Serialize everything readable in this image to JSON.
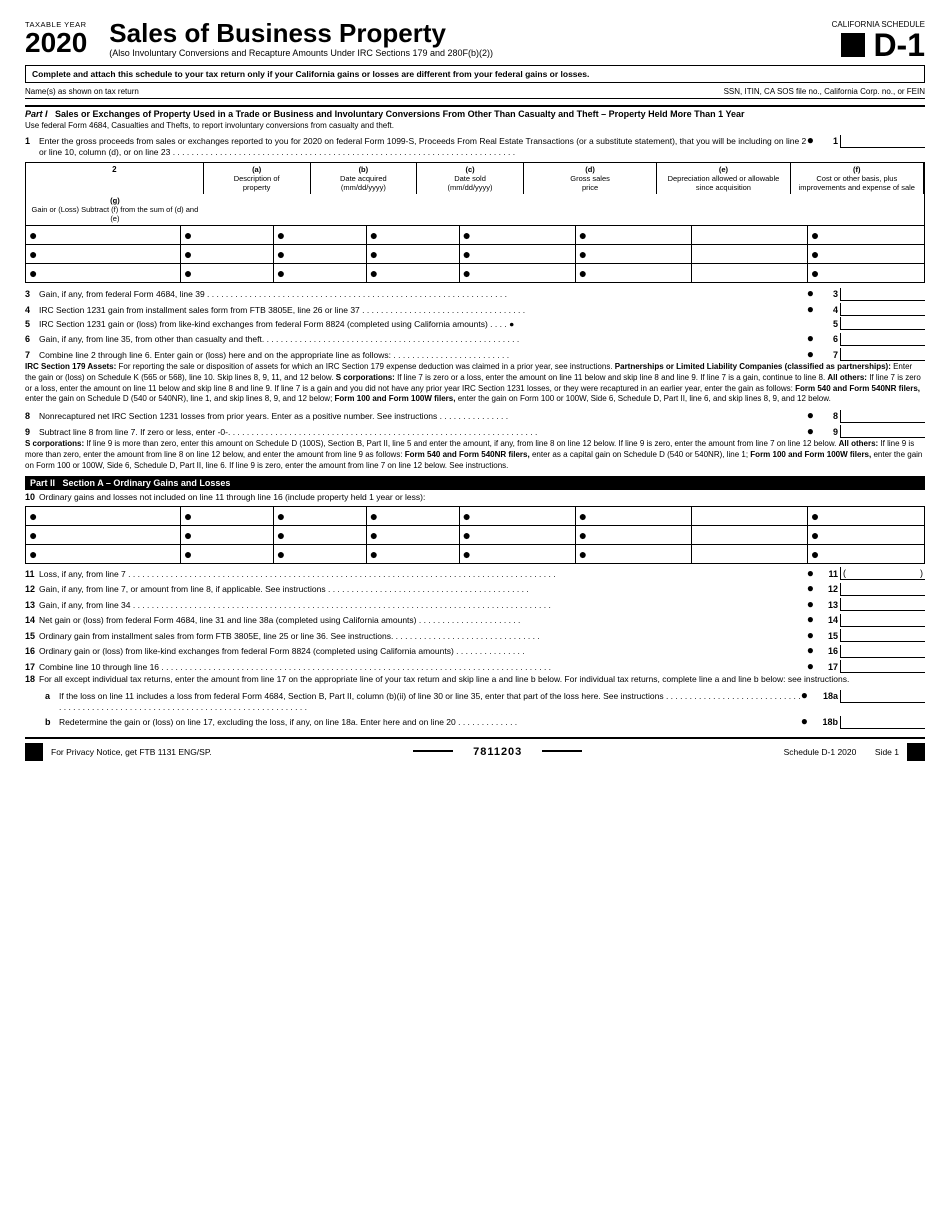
{
  "header": {
    "taxable_year_label": "TAXABLE YEAR",
    "year": "2020",
    "main_title": "Sales of Business Property",
    "subtitle": "(Also Involuntary Conversions and Recapture Amounts Under IRC Sections 179 and 280F(b)(2))",
    "ca_schedule": "CALIFORNIA SCHEDULE",
    "form_id": "D-1"
  },
  "warning": {
    "text_bold": "Complete and attach this schedule to your tax return only if your California gains or losses are different from your federal gains or losses.",
    "name_label": "Name(s) as shown on tax return",
    "ssn_label": "SSN, ITIN, CA SOS file no., California Corp. no., or FEIN"
  },
  "part1": {
    "label": "Part I",
    "title": "Sales or Exchanges of Property Used in a Trade or Business and Involuntary Conversions From Other Than Casualty and Theft – Property Held More Than 1 Year",
    "instruction": "Use federal Form 4684, Casualties and Thefts, to report involuntary conversions from casualty and theft.",
    "line1_text": "Enter the gross proceeds from sales or exchanges reported to you for 2020 on federal Form 1099-S, Proceeds From Real Estate Transactions (or a substitute statement), that you will be including on line 2 or line 10, column (d), or on line 23",
    "line1_num": "1",
    "table_col_a": "(a)\nDescription of property",
    "table_col_b": "(b)\nDate acquired\n(mm/dd/yyyy)",
    "table_col_c": "(c)\nDate sold\n(mm/dd/yyyy)",
    "table_col_d": "(d)\nGross sales\nprice",
    "table_col_e": "(e)\nDepreciation allowed or allowable since acquisition",
    "table_col_f": "(f)\nCost or other basis, plus improvements and expense of sale",
    "table_col_g": "(g)\nGain or (Loss) Subtract (f) from the sum of (d) and (e)",
    "line2_num": "2",
    "line3_text": "Gain, if any, from federal Form 4684, line 39",
    "line3_num": "3",
    "line4_text": "IRC Section 1231 gain from installment sales form from FTB 3805E, line 26 or line 37",
    "line4_num": "4",
    "line5_text": "IRC Section 1231 gain or (loss) from like-kind exchanges from federal Form 8824 (completed using California amounts)",
    "line5_num": "5",
    "line6_text": "Gain, if any, from line 35, from other than casualty and theft.",
    "line6_num": "6",
    "line7_text": "Combine line 2 through line 6. Enter gain or (loss) here and on the appropriate line as follows:",
    "line7_num": "7",
    "irc179_text": "IRC Section 179 Assets: For reporting the sale or disposition of assets for which an IRC Section 179 expense deduction was claimed in a prior year, see instructions. Partnerships or Limited Liability Companies (classified as partnerships): Enter the gain or (loss) on Schedule K (565 or 568), line 10. Skip lines 8, 9, 11, and 12 below. S corporations: If line 7 is zero or a loss, enter the amount on line 11 below and skip line 8 and line 9. If line 7 is a gain, continue to line 8. All others: If line 7 is zero or a loss, enter the amount on line 11 below and skip line 8 and line 9. If line 7 is a gain and you did not have any prior year IRC Section 1231 losses, or they were recaptured in an earlier year, enter the gain as follows: Form 540 and Form 540NR filers, enter the gain on Schedule D (540 or 540NR), line 1, and skip lines 8, 9, and 12 below; Form 100 and Form 100W filers, enter the gain on Form 100 or 100W, Side 6, Schedule D, Part II, line 6, and skip lines 8, 9, and 12 below.",
    "line8_text": "Nonrecaptured net IRC Section 1231 losses from prior years. Enter as a positive number. See instructions",
    "line8_num": "8",
    "line9_text": "Subtract line 8 from line 7. If zero or less, enter -0-.",
    "line9_num": "9",
    "scorp_text": "S corporations: If line 9 is more than zero, enter this amount on Schedule D (100S), Section B, Part II, line 5 and enter the amount, if any, from line 8 on line 12 below. If line 9 is zero, enter the amount from line 7 on line 12 below. All others: If line 9 is more than zero, enter the amount from line 8 on line 12 below, and enter the amount from line 9 as follows: Form 540 and Form 540NR filers, enter as a capital gain on Schedule D (540 or 540NR), line 1; Form 100 and Form 100W filers, enter the gain on Form 100 or 100W, Side 6, Schedule D, Part II, line 6. If line 9 is zero, enter the amount from line 7 on line 12 below. See instructions."
  },
  "part2": {
    "label": "Part II",
    "title": "Section A – Ordinary Gains and Losses",
    "line10_text": "Ordinary gains and losses not included on line 11 through line 16 (include property held 1 year or less):",
    "line10_num": "10",
    "line11_text": "Loss, if any, from line 7",
    "line11_num": "11",
    "line11_paren_open": "(",
    "line11_paren_close": ")",
    "line12_text": "Gain, if any, from line 7, or amount from line 8, if applicable. See instructions",
    "line12_num": "12",
    "line13_text": "Gain, if any, from line 34",
    "line13_num": "13",
    "line14_text": "Net gain or (loss) from federal Form 4684, line 31 and line 38a (completed using California amounts)",
    "line14_num": "14",
    "line15_text": "Ordinary gain from installment sales from form FTB 3805E, line 25 or line 36. See instructions.",
    "line15_num": "15",
    "line16_text": "Ordinary gain or (loss) from like-kind exchanges from federal Form 8824 (completed using California amounts)",
    "line16_num": "16",
    "line17_text": "Combine line 10 through line 16",
    "line17_num": "17",
    "line18_text": "For all except individual tax returns, enter the amount from line 17 on the appropriate line of your tax return and skip line a and line b below. For individual tax returns, complete line a and line b below: see instructions.",
    "line18_num": "18",
    "line18a_text": "If the loss on line 11 includes a loss from federal Form 4684, Section B, Part II, column (b)(ii) of line 30 or line 35, enter that part of the loss here. See instructions",
    "line18a_label": "a",
    "line18a_num": "18a",
    "line18b_text": "Redetermine the gain or (loss) on line 17, excluding the loss, if any, on line 18a. Enter here and on line 20",
    "line18b_label": "b",
    "line18b_num": "18b"
  },
  "footer": {
    "privacy_notice": "For Privacy Notice, get FTB 1131 ENG/SP.",
    "form_code": "7811203",
    "schedule_label": "Schedule D-1 2020",
    "side": "Side 1"
  }
}
